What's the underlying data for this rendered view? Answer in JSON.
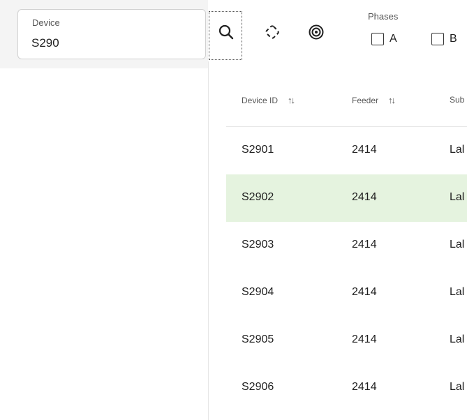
{
  "search_panel": {
    "device_label": "Device",
    "device_value": "S290"
  },
  "toolbar": {
    "icons": [
      "search-icon",
      "link-off-icon",
      "target-icon"
    ]
  },
  "phases": {
    "label": "Phases",
    "options": [
      {
        "label": "A",
        "checked": false
      },
      {
        "label": "B",
        "checked": false
      }
    ]
  },
  "table": {
    "columns": [
      "Device ID",
      "Feeder",
      "Sub"
    ],
    "selected_row_index": 1,
    "selected_color": "#e5f3df",
    "rows": [
      {
        "device_id": "S2901",
        "feeder": "2414",
        "sub": "Lal"
      },
      {
        "device_id": "S2902",
        "feeder": "2414",
        "sub": "Lal"
      },
      {
        "device_id": "S2903",
        "feeder": "2414",
        "sub": "Lal"
      },
      {
        "device_id": "S2904",
        "feeder": "2414",
        "sub": "Lal"
      },
      {
        "device_id": "S2905",
        "feeder": "2414",
        "sub": "Lal"
      },
      {
        "device_id": "S2906",
        "feeder": "2414",
        "sub": "Lal"
      }
    ]
  }
}
